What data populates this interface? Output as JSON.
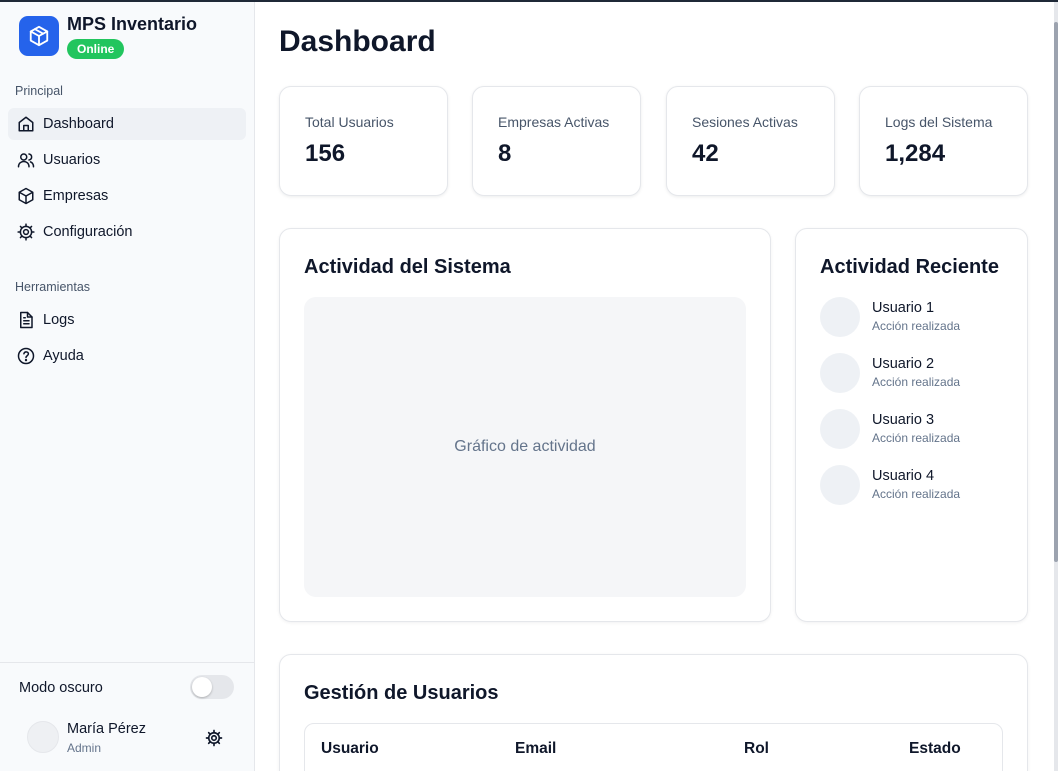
{
  "brand": {
    "name": "MPS Inventario",
    "status": "Online",
    "accent": "#2563eb",
    "status_color": "#22c55e"
  },
  "sidebar": {
    "sections": [
      {
        "label": "Principal",
        "items": [
          {
            "label": "Dashboard",
            "icon": "home-icon",
            "active": true
          },
          {
            "label": "Usuarios",
            "icon": "users-icon"
          },
          {
            "label": "Empresas",
            "icon": "box-icon"
          },
          {
            "label": "Configuración",
            "icon": "gear-icon"
          }
        ]
      },
      {
        "label": "Herramientas",
        "items": [
          {
            "label": "Logs",
            "icon": "file-text-icon"
          },
          {
            "label": "Ayuda",
            "icon": "help-circle-icon"
          }
        ]
      }
    ],
    "dark_mode": {
      "label": "Modo oscuro",
      "enabled": false
    },
    "user": {
      "name": "María Pérez",
      "role": "Admin"
    }
  },
  "main": {
    "title": "Dashboard",
    "stats": [
      {
        "label": "Total Usuarios",
        "value": "156"
      },
      {
        "label": "Empresas Activas",
        "value": "8"
      },
      {
        "label": "Sesiones Activas",
        "value": "42"
      },
      {
        "label": "Logs del Sistema",
        "value": "1,284"
      }
    ],
    "activity_panel": {
      "title": "Actividad del Sistema",
      "placeholder": "Gráfico de actividad"
    },
    "recent_panel": {
      "title": "Actividad Reciente",
      "items": [
        {
          "name": "Usuario 1",
          "desc": "Acción realizada"
        },
        {
          "name": "Usuario 2",
          "desc": "Acción realizada"
        },
        {
          "name": "Usuario 3",
          "desc": "Acción realizada"
        },
        {
          "name": "Usuario 4",
          "desc": "Acción realizada"
        }
      ]
    },
    "users_panel": {
      "title": "Gestión de Usuarios",
      "columns": [
        "Usuario",
        "Email",
        "Rol",
        "Estado"
      ]
    }
  }
}
